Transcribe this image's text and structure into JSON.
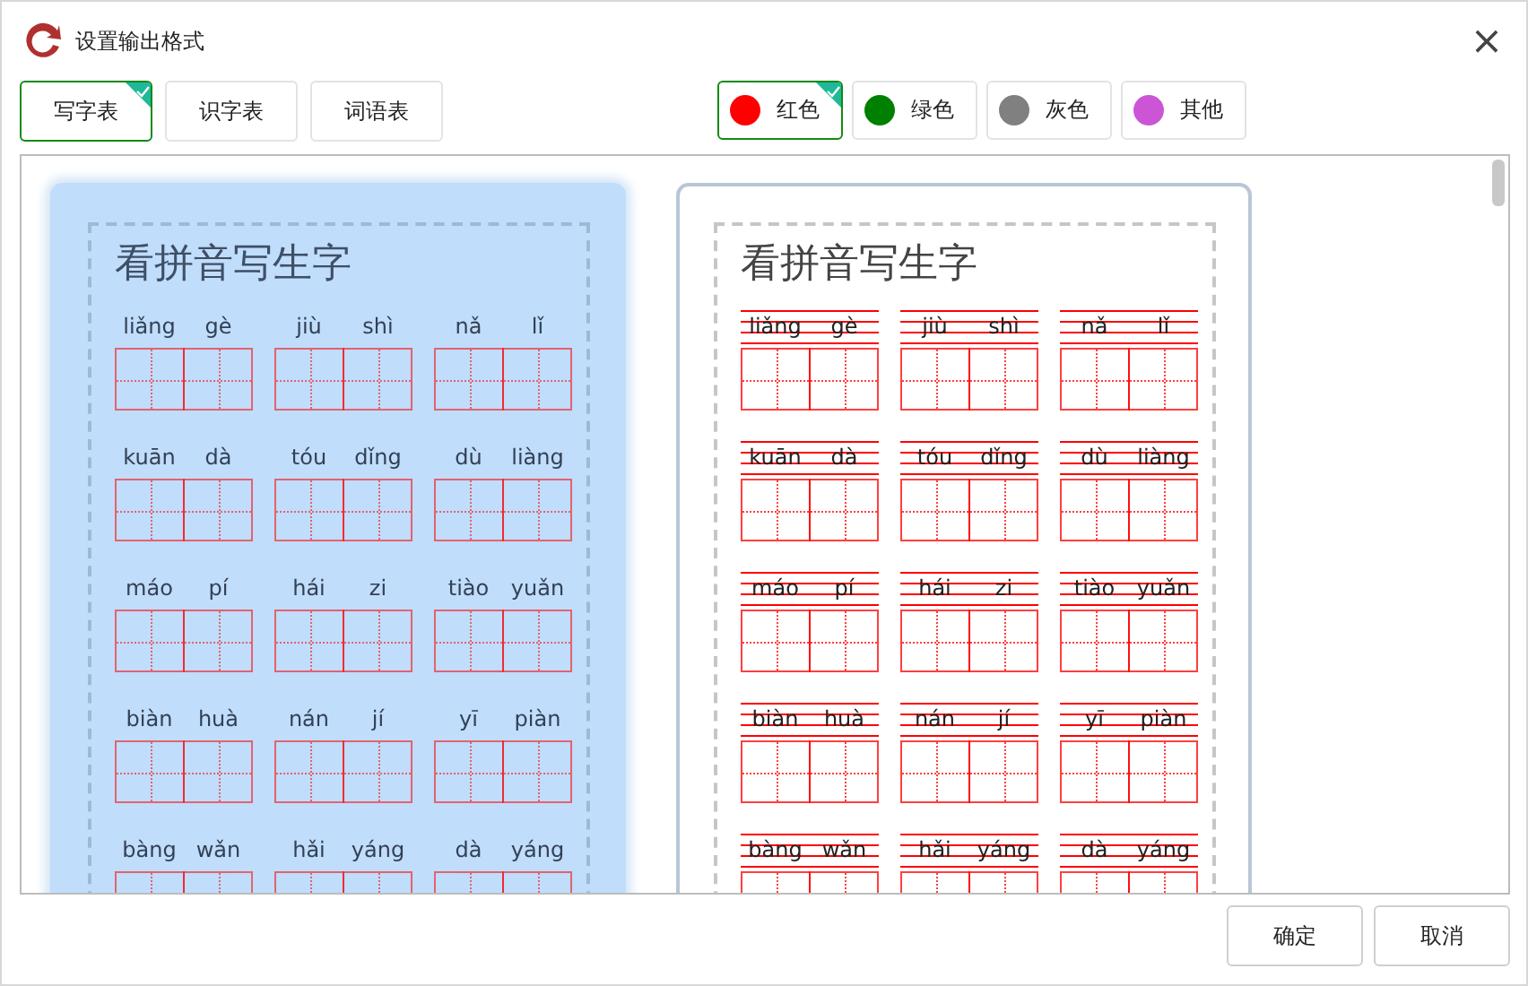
{
  "window": {
    "title": "设置输出格式",
    "close": "×"
  },
  "formats": [
    {
      "label": "写字表",
      "selected": true
    },
    {
      "label": "识字表",
      "selected": false
    },
    {
      "label": "词语表",
      "selected": false
    }
  ],
  "colors": [
    {
      "label": "红色",
      "color": "#ff0000",
      "selected": true
    },
    {
      "label": "绿色",
      "color": "#008000",
      "selected": false
    },
    {
      "label": "灰色",
      "color": "#808080",
      "selected": false
    },
    {
      "label": "其他",
      "color": "#cc55d5",
      "selected": false
    }
  ],
  "cards": [
    {
      "kind": "plain",
      "selected": true,
      "title": "看拼音写生字",
      "rows": [
        [
          [
            "liǎng",
            "gè"
          ],
          [
            "jiù",
            "shì"
          ],
          [
            "nǎ",
            "lǐ"
          ]
        ],
        [
          [
            "kuān",
            "dà"
          ],
          [
            "tóu",
            "dǐng"
          ],
          [
            "dù",
            "liàng"
          ]
        ],
        [
          [
            "máo",
            "pí"
          ],
          [
            "hái",
            "zi"
          ],
          [
            "tiào",
            "yuǎn"
          ]
        ],
        [
          [
            "biàn",
            "huà"
          ],
          [
            "nán",
            "jí"
          ],
          [
            "yī",
            "piàn"
          ]
        ],
        [
          [
            "bàng",
            "wǎn"
          ],
          [
            "hǎi",
            "yáng"
          ],
          [
            "dà",
            "yáng"
          ]
        ]
      ]
    },
    {
      "kind": "lined",
      "selected": false,
      "title": "看拼音写生字",
      "rows": [
        [
          [
            "liǎng",
            "gè"
          ],
          [
            "jiù",
            "shì"
          ],
          [
            "nǎ",
            "lǐ"
          ]
        ],
        [
          [
            "kuān",
            "dà"
          ],
          [
            "tóu",
            "dǐng"
          ],
          [
            "dù",
            "liàng"
          ]
        ],
        [
          [
            "máo",
            "pí"
          ],
          [
            "hái",
            "zi"
          ],
          [
            "tiào",
            "yuǎn"
          ]
        ],
        [
          [
            "biàn",
            "huà"
          ],
          [
            "nán",
            "jí"
          ],
          [
            "yī",
            "piàn"
          ]
        ],
        [
          [
            "bàng",
            "wǎn"
          ],
          [
            "hǎi",
            "yáng"
          ],
          [
            "dà",
            "yáng"
          ]
        ]
      ]
    }
  ],
  "buttons": [
    "确定",
    "取消"
  ]
}
